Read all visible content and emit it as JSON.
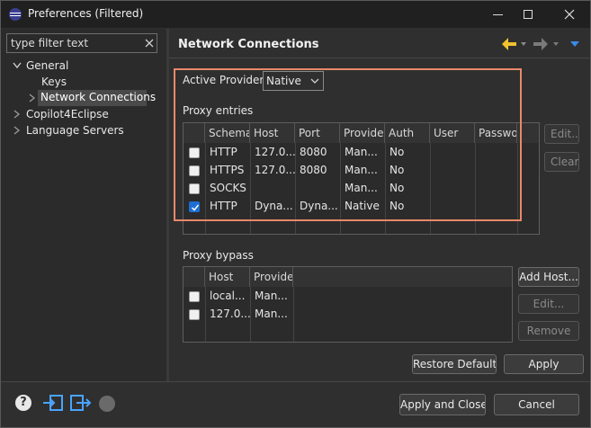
{
  "window": {
    "title": "Preferences (Filtered)"
  },
  "sidebar": {
    "filter_value": "type filter text",
    "tree": [
      {
        "label": "General"
      },
      {
        "label": "Keys"
      },
      {
        "label": "Network Connections"
      },
      {
        "label": "Copilot4Eclipse"
      },
      {
        "label": "Language Servers"
      }
    ]
  },
  "page": {
    "title": "Network Connections",
    "active_provider_label": "Active Provider:",
    "active_provider_value": "Native",
    "proxy_entries": {
      "label": "Proxy entries",
      "columns": [
        "Schema",
        "Host",
        "Port",
        "Provide",
        "Auth",
        "User",
        "Passwo"
      ],
      "rows": [
        {
          "checked": false,
          "schema": "HTTP",
          "host": "127.0...",
          "port": "8080",
          "provider": "Man...",
          "auth": "No"
        },
        {
          "checked": false,
          "schema": "HTTPS",
          "host": "127.0...",
          "port": "8080",
          "provider": "Man...",
          "auth": "No"
        },
        {
          "checked": false,
          "schema": "SOCKS",
          "host": "",
          "port": "",
          "provider": "Man...",
          "auth": "No"
        },
        {
          "checked": true,
          "schema": "HTTP",
          "host": "Dyna...",
          "port": "Dyna...",
          "provider": "Native",
          "auth": "No"
        }
      ],
      "edit_button": "Edit...",
      "clear_button": "Clear"
    },
    "proxy_bypass": {
      "label": "Proxy bypass",
      "columns": [
        "Host",
        "Provide"
      ],
      "rows": [
        {
          "checked": false,
          "host": "local...",
          "provider": "Man..."
        },
        {
          "checked": false,
          "host": "127.0...",
          "provider": "Man..."
        }
      ],
      "add_host_button": "Add Host...",
      "edit_button": "Edit...",
      "remove_button": "Remove"
    },
    "restore_defaults_button": "Restore Defaults",
    "apply_button": "Apply"
  },
  "footer": {
    "apply_close_button": "Apply and Close",
    "cancel_button": "Cancel",
    "icons": [
      "help-icon",
      "import-icon",
      "export-icon",
      "oomph-icon"
    ]
  },
  "colors": {
    "highlight_box": "#e8896a",
    "accent_blue": "#1d6fd6",
    "nav_arrow_yellow": "#f2c12e"
  }
}
